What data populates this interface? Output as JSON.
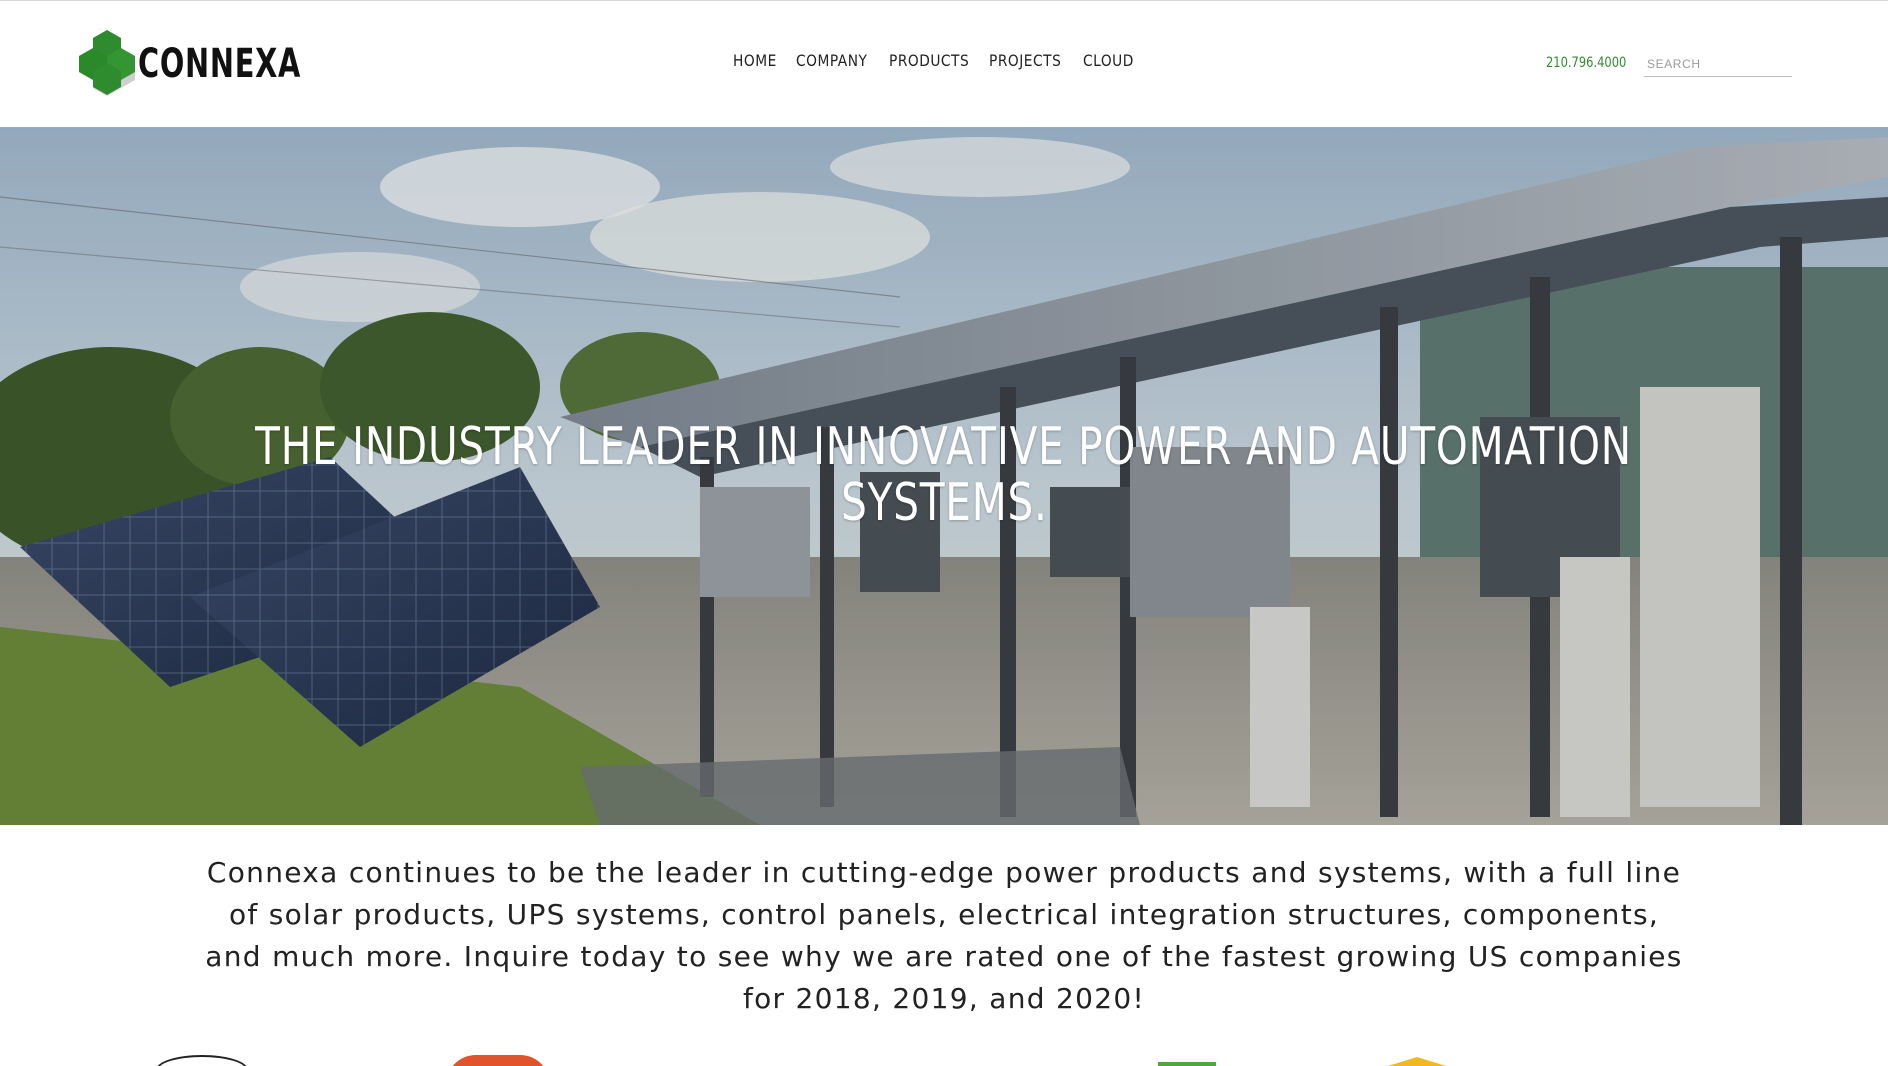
{
  "brand": {
    "name": "CONNEXA",
    "accent_color": "#2e8b2e",
    "logo_icon": "hexagon-cluster-logo"
  },
  "nav": {
    "items": [
      {
        "label": "HOME"
      },
      {
        "label": "COMPANY"
      },
      {
        "label": "PRODUCTS"
      },
      {
        "label": "PROJECTS"
      },
      {
        "label": "CLOUD"
      }
    ]
  },
  "header": {
    "phone": "210.796.4000",
    "search_placeholder": "SEARCH",
    "search_value": ""
  },
  "hero": {
    "title_line1": "THE INDUSTRY LEADER IN INNOVATIVE POWER AND AUTOMATION",
    "title_line2": "SYSTEMS.",
    "image_subject": "solar-panels-and-electrical-enclosures-photo"
  },
  "intro": {
    "text": "Connexa continues to be the leader in cutting-edge power products and systems, with a full line of solar products, UPS systems, control panels, electrical integration structures, components, and much more.  Inquire today to see why we are rated one of the fastest growing US companies for 2018, 2019, and 2020!"
  },
  "badges": [
    {
      "icon": "fastest-growing-badge-icon"
    },
    {
      "icon": "orange-award-badge-icon"
    },
    {
      "icon": "green-award-badge-icon"
    },
    {
      "icon": "yellow-award-badge-icon"
    }
  ]
}
